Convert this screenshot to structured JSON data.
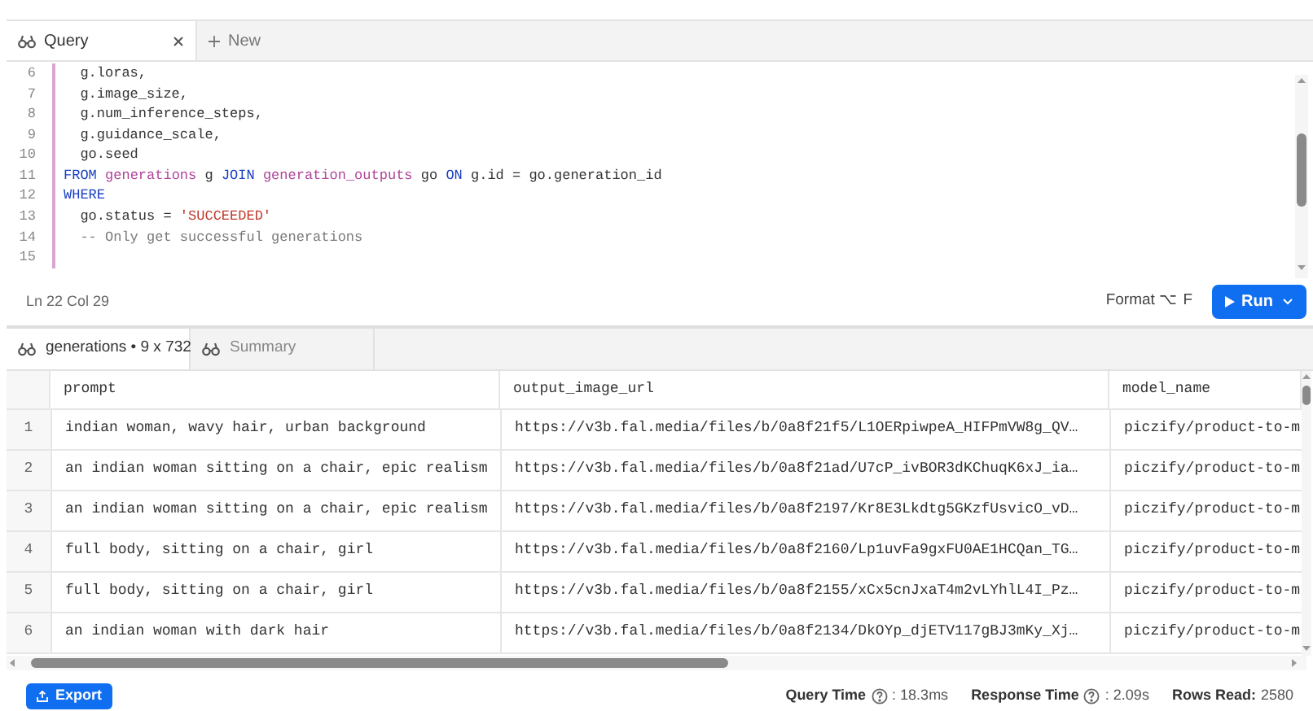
{
  "tabs": [
    {
      "label": "Query",
      "selected": true,
      "closable": true
    },
    {
      "label": "New",
      "selected": false,
      "closable": false
    }
  ],
  "editor": {
    "lines": [
      {
        "number": "6",
        "tokens": [
          {
            "kind": "plain",
            "text": "  g.loras,"
          }
        ]
      },
      {
        "number": "7",
        "tokens": [
          {
            "kind": "plain",
            "text": "  g.image_size,"
          }
        ]
      },
      {
        "number": "8",
        "tokens": [
          {
            "kind": "plain",
            "text": "  g.num_inference_steps,"
          }
        ]
      },
      {
        "number": "9",
        "tokens": [
          {
            "kind": "plain",
            "text": "  g.guidance_scale,"
          }
        ]
      },
      {
        "number": "10",
        "tokens": [
          {
            "kind": "plain",
            "text": "  go.seed"
          }
        ]
      },
      {
        "number": "11",
        "tokens": [
          {
            "kind": "keyword",
            "text": "FROM "
          },
          {
            "kind": "table",
            "text": "generations"
          },
          {
            "kind": "plain",
            "text": " g "
          },
          {
            "kind": "keyword",
            "text": "JOIN "
          },
          {
            "kind": "table",
            "text": "generation_outputs"
          },
          {
            "kind": "plain",
            "text": " go "
          },
          {
            "kind": "keyword",
            "text": "ON"
          },
          {
            "kind": "plain",
            "text": " g.id = go.generation_id"
          }
        ]
      },
      {
        "number": "12",
        "tokens": [
          {
            "kind": "keyword",
            "text": "WHERE"
          }
        ]
      },
      {
        "number": "13",
        "tokens": [
          {
            "kind": "plain",
            "text": "  go.status = "
          },
          {
            "kind": "string",
            "text": "'SUCCEEDED'"
          }
        ]
      },
      {
        "number": "14",
        "tokens": [
          {
            "kind": "comment",
            "text": "  -- Only get successful generations"
          }
        ]
      },
      {
        "number": "15"
      }
    ],
    "cursor": "Ln 22 Col 29",
    "format_label": "Format ⌥ F",
    "run_label": "Run"
  },
  "result_tabs": [
    {
      "label": "generations • 9 x 732",
      "selected": true
    },
    {
      "label": "Summary",
      "selected": false
    }
  ],
  "table": {
    "columns": [
      "prompt",
      "output_image_url",
      "model_name"
    ],
    "rows": [
      {
        "index": "1",
        "cells": [
          "indian woman, wavy hair, urban background",
          "https://v3b.fal.media/files/b/0a8f21f5/L1OERpiwpeA_HIFPmVW8g_QV…",
          "piczify/product-to-m"
        ]
      },
      {
        "index": "2",
        "cells": [
          "an indian woman sitting on a chair, epic realism",
          "https://v3b.fal.media/files/b/0a8f21ad/U7cP_ivBOR3dKChuqK6xJ_ia…",
          "piczify/product-to-m"
        ]
      },
      {
        "index": "3",
        "cells": [
          "an indian woman sitting on a chair, epic realism",
          "https://v3b.fal.media/files/b/0a8f2197/Kr8E3Lkdtg5GKzfUsvicO_vD…",
          "piczify/product-to-m"
        ]
      },
      {
        "index": "4",
        "cells": [
          "full body, sitting on a chair, girl",
          "https://v3b.fal.media/files/b/0a8f2160/Lp1uvFa9gxFU0AE1HCQan_TG…",
          "piczify/product-to-m"
        ]
      },
      {
        "index": "5",
        "cells": [
          "full body, sitting on a chair, girl",
          "https://v3b.fal.media/files/b/0a8f2155/xCx5cnJxaT4m2vLYhlL4I_Pz…",
          "piczify/product-to-m"
        ]
      },
      {
        "index": "6",
        "cells": [
          "an indian woman with dark hair",
          "https://v3b.fal.media/files/b/0a8f2134/DkOYp_djETV117gBJ3mKy_Xj…",
          "piczify/product-to-m"
        ]
      }
    ]
  },
  "footer": {
    "export_label": "Export",
    "stats": [
      {
        "label": "Query Time",
        "help": true,
        "value": ": 18.3ms"
      },
      {
        "label": "Response Time",
        "help": true,
        "value": ": 2.09s"
      },
      {
        "label": "Rows Read:",
        "help": false,
        "value": "2580"
      }
    ]
  }
}
